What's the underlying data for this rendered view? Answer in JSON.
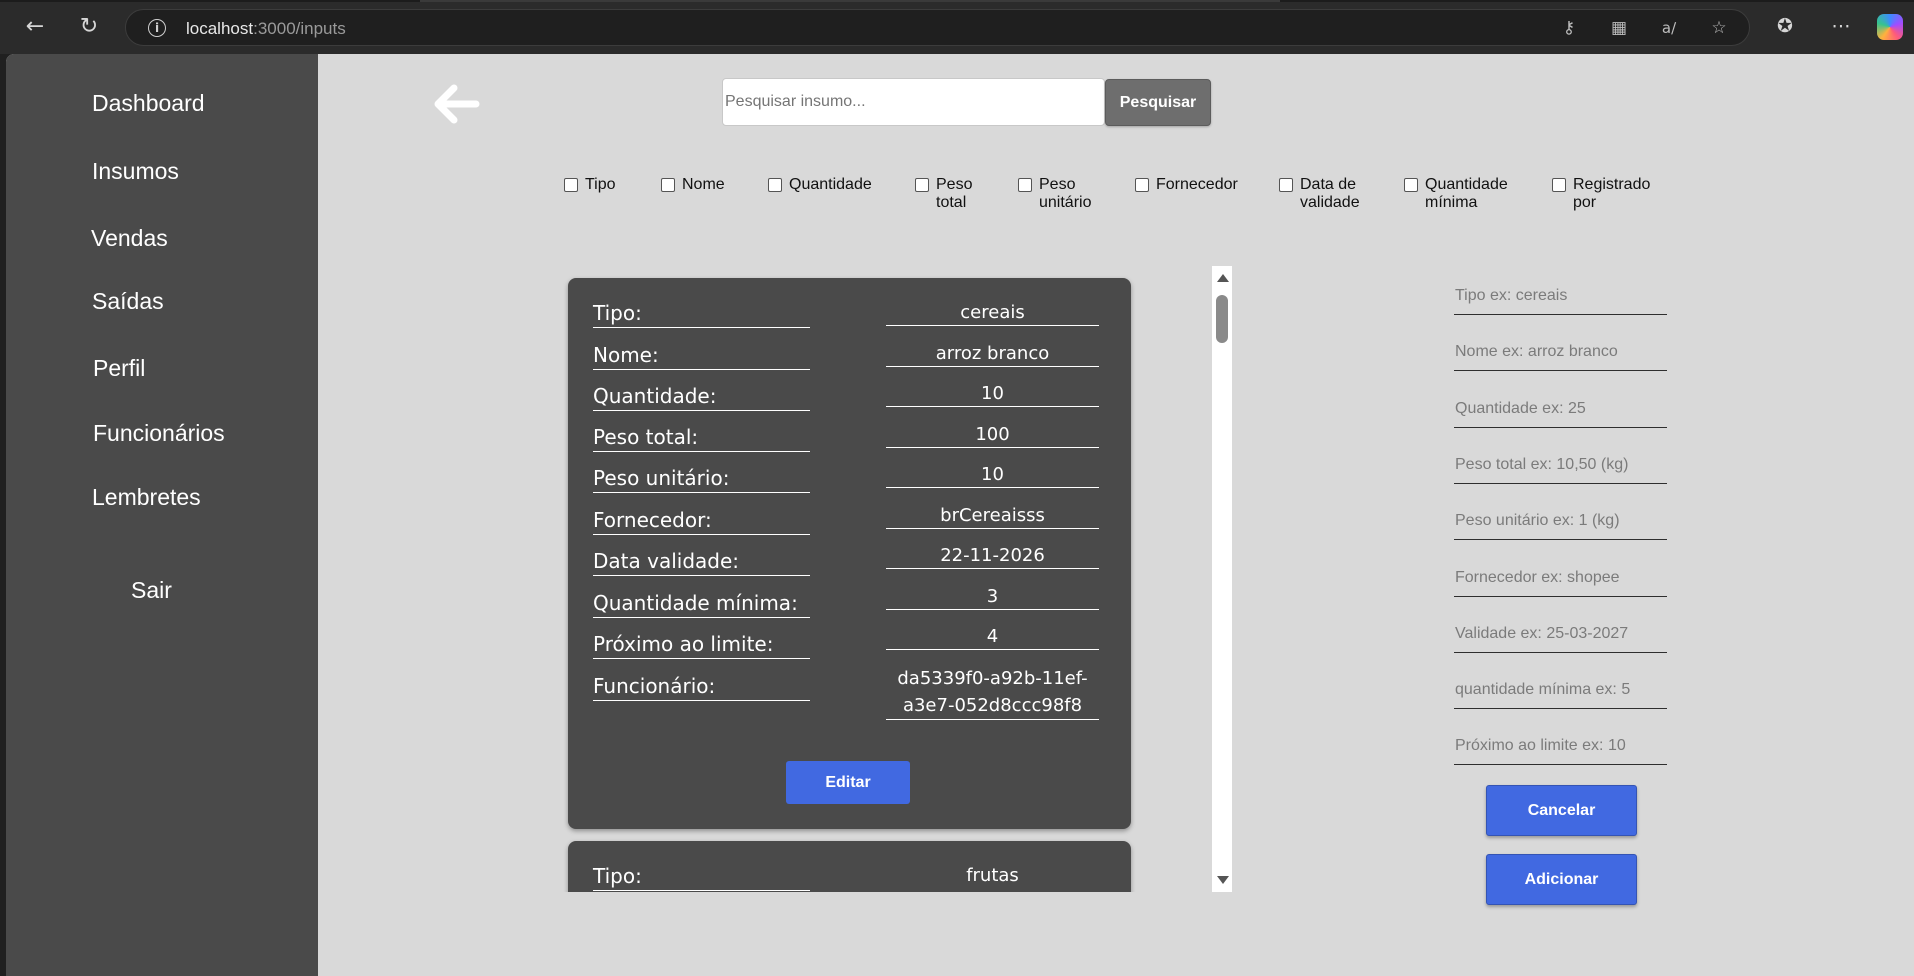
{
  "browser": {
    "url_host": "localhost",
    "url_path": ":3000/inputs"
  },
  "sidebar": {
    "items": [
      {
        "label": "Dashboard"
      },
      {
        "label": "Insumos"
      },
      {
        "label": "Vendas"
      },
      {
        "label": "Saídas"
      },
      {
        "label": "Perfil"
      },
      {
        "label": "Funcionários"
      },
      {
        "label": "Lembretes"
      }
    ],
    "logout_label": "Sair"
  },
  "search": {
    "placeholder": "Pesquisar insumo...",
    "button_label": "Pesquisar"
  },
  "filters": [
    {
      "label_line1": "Tipo",
      "label_line2": ""
    },
    {
      "label_line1": "Nome",
      "label_line2": ""
    },
    {
      "label_line1": "Quantidade",
      "label_line2": ""
    },
    {
      "label_line1": "Peso",
      "label_line2": "total"
    },
    {
      "label_line1": "Peso",
      "label_line2": "unitário"
    },
    {
      "label_line1": "Fornecedor",
      "label_line2": ""
    },
    {
      "label_line1": "Data de",
      "label_line2": "validade"
    },
    {
      "label_line1": "Quantidade",
      "label_line2": "mínima"
    },
    {
      "label_line1": "Registrado",
      "label_line2": "por"
    }
  ],
  "cards": [
    {
      "rows": [
        {
          "label": "Tipo:",
          "value": "cereais"
        },
        {
          "label": "Nome:",
          "value": "arroz branco"
        },
        {
          "label": "Quantidade:",
          "value": "10"
        },
        {
          "label": "Peso total:",
          "value": "100"
        },
        {
          "label": "Peso unitário:",
          "value": "10"
        },
        {
          "label": "Fornecedor:",
          "value": "brCereaisss"
        },
        {
          "label": "Data validade:",
          "value": "22-11-2026"
        },
        {
          "label": "Quantidade mínima:",
          "value": "3"
        },
        {
          "label": "Próximo ao limite:",
          "value": "4"
        },
        {
          "label": "Funcionário:",
          "value": "da5339f0-a92b-11ef-a3e7-052d8ccc98f8"
        }
      ],
      "edit_label": "Editar"
    },
    {
      "rows": [
        {
          "label": "Tipo:",
          "value": "frutas"
        }
      ]
    }
  ],
  "form": {
    "placeholders": [
      "Tipo ex: cereais",
      "Nome ex: arroz branco",
      "Quantidade ex: 25",
      "Peso total ex: 10,50 (kg)",
      "Peso unitário ex: 1 (kg)",
      "Fornecedor ex: shopee",
      "Validade ex: 25-03-2027",
      "quantidade mínima ex: 5",
      "Próximo ao limite ex: 10"
    ],
    "cancel_label": "Cancelar",
    "add_label": "Adicionar"
  },
  "colors": {
    "sidebar_bg": "#4a4a4a",
    "page_bg": "#d9d9d9",
    "card_bg": "#4a4a4a",
    "primary_button": "#4169e1",
    "search_button": "#6e6e6e"
  }
}
